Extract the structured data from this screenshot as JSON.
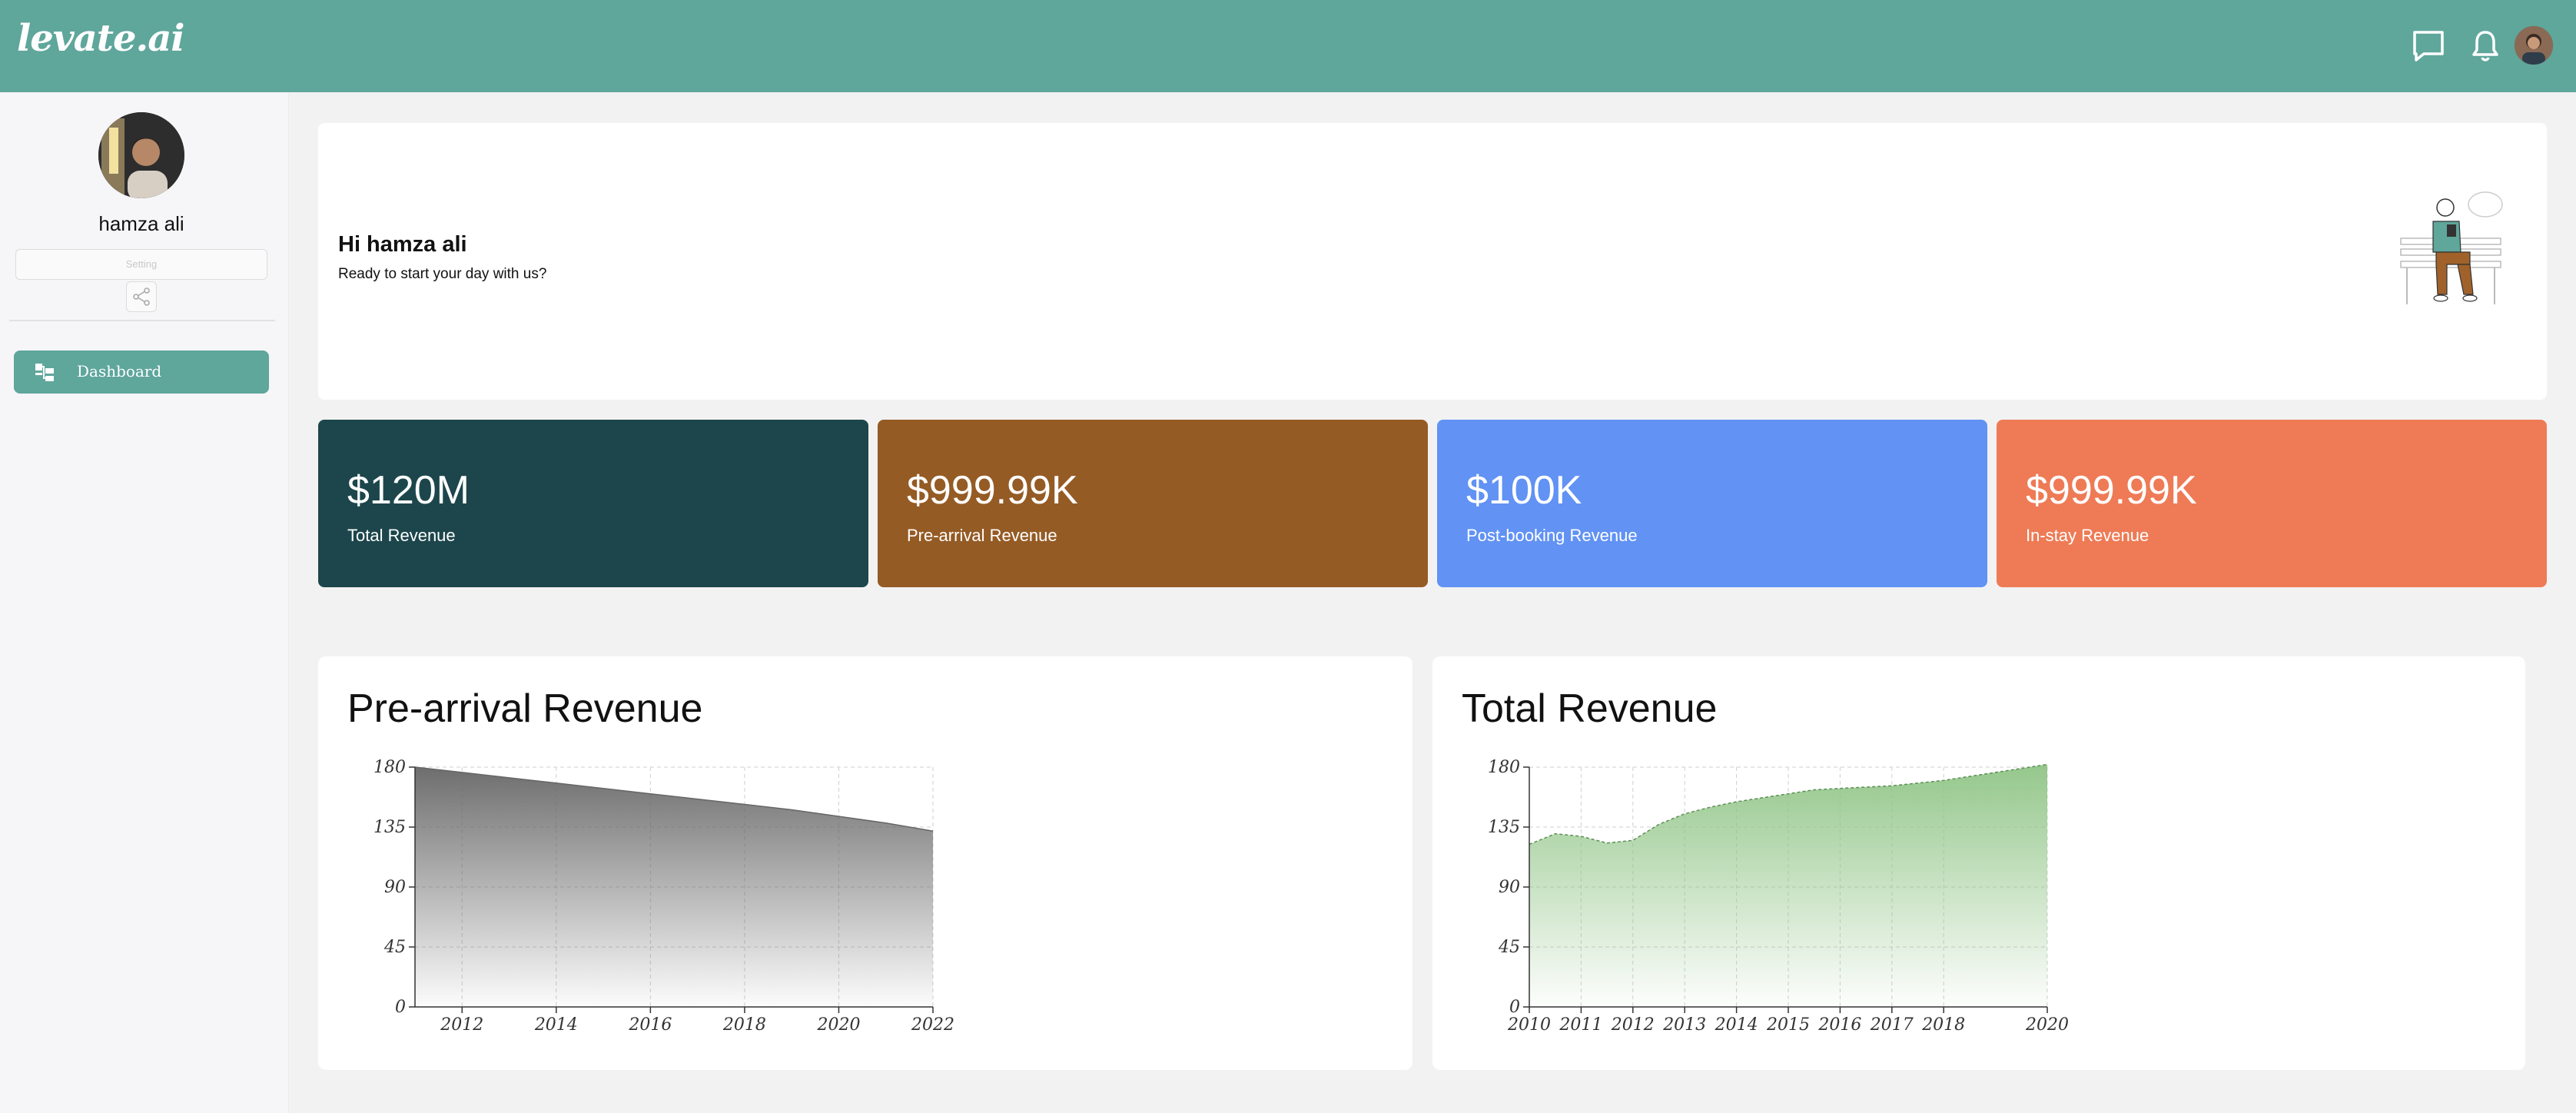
{
  "app": {
    "logo_text": "levate.ai",
    "brand_color": "#5fa69b"
  },
  "header": {
    "icons": [
      "message-icon",
      "bell-icon",
      "user-avatar"
    ]
  },
  "sidebar": {
    "user_name": "hamza ali",
    "setting_label": "Setting",
    "nav": [
      {
        "label": "Dashboard",
        "icon": "dashboard-icon",
        "active": true
      }
    ]
  },
  "welcome": {
    "title": "Hi hamza ali",
    "subtitle": "Ready to start your day with us?"
  },
  "stats": [
    {
      "value": "$120M",
      "label": "Total Revenue",
      "color": "#1c464b"
    },
    {
      "value": "$999.99K",
      "label": "Pre-arrival Revenue",
      "color": "#955b25"
    },
    {
      "value": "$100K",
      "label": "Post-booking Revenue",
      "color": "#6192f4"
    },
    {
      "value": "$999.99K",
      "label": "In-stay Revenue",
      "color": "#ee7b56"
    }
  ],
  "chart_data": [
    {
      "type": "area",
      "title": "Pre-arrival Revenue",
      "x": [
        2011,
        2012,
        2013,
        2014,
        2015,
        2016,
        2017,
        2018,
        2019,
        2020,
        2021,
        2022
      ],
      "x_ticks": [
        "2012",
        "2014",
        "2016",
        "2018",
        "2020",
        "2022"
      ],
      "y_ticks": [
        "0",
        "45",
        "90",
        "135",
        "180"
      ],
      "values": [
        180,
        176,
        172,
        168,
        164,
        160,
        156,
        152,
        148,
        143,
        138,
        132
      ],
      "xlim": [
        2011,
        2022
      ],
      "ylim": [
        0,
        180
      ],
      "grid": true,
      "fill_color": "#666666"
    },
    {
      "type": "area",
      "title": "Total Revenue",
      "x_ticks": [
        "2010",
        "2011",
        "2012",
        "2013",
        "2014",
        "2015",
        "2016",
        "2017",
        "2018",
        "2020"
      ],
      "y_ticks": [
        "0",
        "45",
        "90",
        "135",
        "180"
      ],
      "x": [
        2010,
        2010.5,
        2011,
        2011.5,
        2012,
        2012.5,
        2013,
        2013.5,
        2014,
        2014.5,
        2015,
        2015.5,
        2016,
        2016.5,
        2017,
        2017.5,
        2018,
        2018.5,
        2019,
        2019.5,
        2020
      ],
      "values": [
        122,
        130,
        128,
        123,
        125,
        137,
        145,
        150,
        154,
        157,
        160,
        163,
        164,
        165,
        166,
        168,
        170,
        173,
        176,
        179,
        182
      ],
      "ylim": [
        0,
        180
      ],
      "grid": true,
      "fill_color": "#8fc485"
    }
  ]
}
